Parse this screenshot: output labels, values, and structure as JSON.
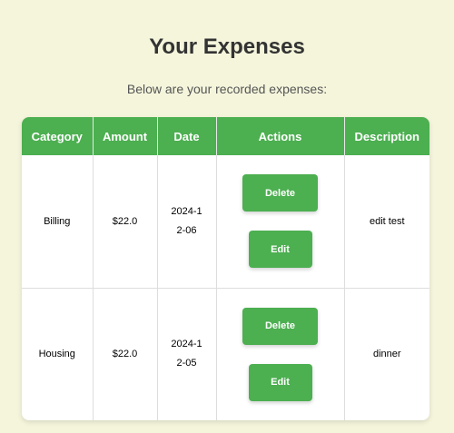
{
  "page": {
    "title": "Your Expenses",
    "subtitle": "Below are your recorded expenses:"
  },
  "table": {
    "headers": [
      "Category",
      "Amount",
      "Date",
      "Actions",
      "Description"
    ],
    "rows": [
      {
        "category": "Billing",
        "amount": "$22.0",
        "date": "2024-12-06",
        "description": "edit test",
        "delete_label": "Delete",
        "edit_label": "Edit"
      },
      {
        "category": "Housing",
        "amount": "$22.0",
        "date": "2024-12-05",
        "description": "dinner",
        "delete_label": "Delete",
        "edit_label": "Edit"
      }
    ]
  },
  "colors": {
    "background": "#f5f5dc",
    "accent": "#4caf50",
    "title": "#333333"
  }
}
